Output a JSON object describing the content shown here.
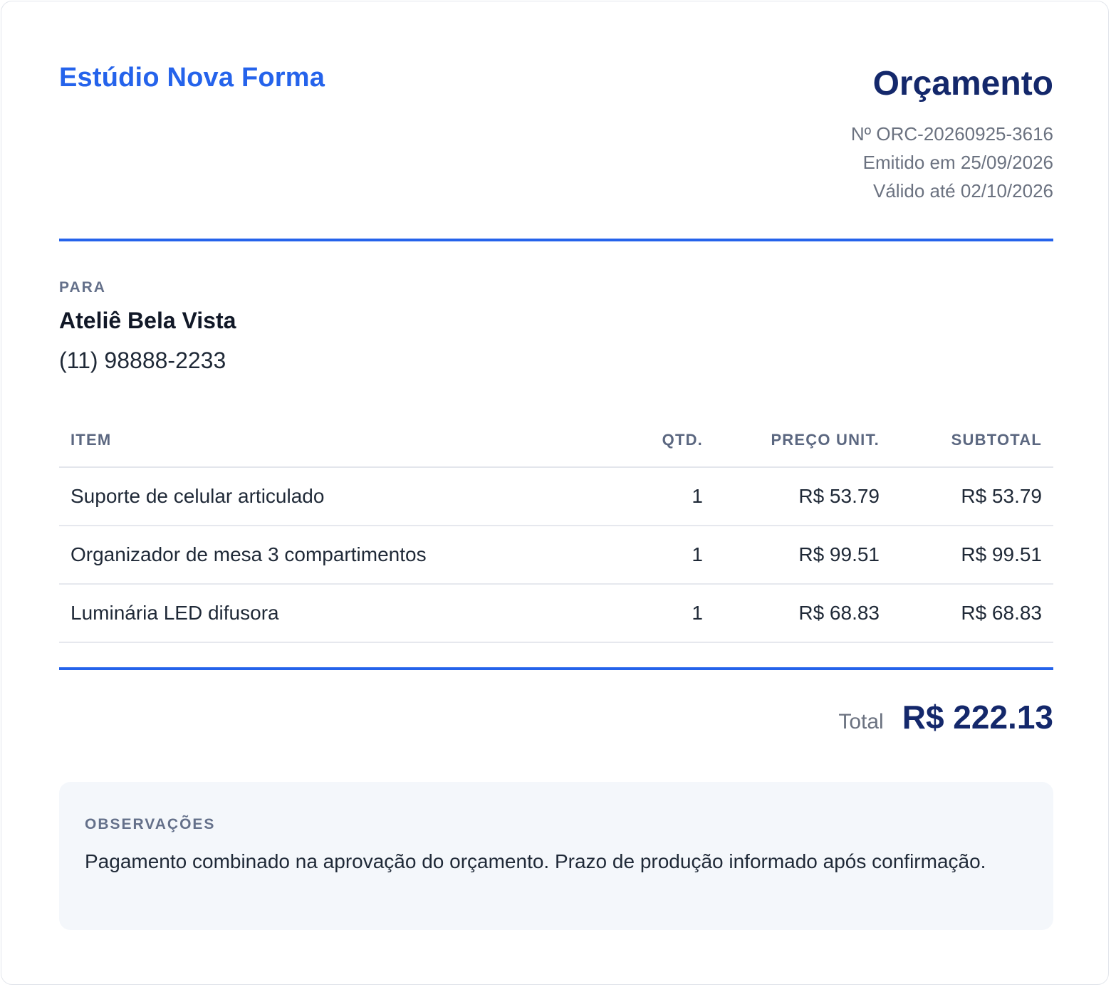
{
  "brand": {
    "name": "Estúdio Nova Forma"
  },
  "document": {
    "title": "Orçamento",
    "number": "Nº ORC-20260925-3616",
    "issued": "Emitido em 25/09/2026",
    "valid_until": "Válido até 02/10/2026"
  },
  "client": {
    "label": "PARA",
    "name": "Ateliê Bela Vista",
    "phone": "(11) 98888-2233"
  },
  "items_table": {
    "headers": {
      "item": "ITEM",
      "qty": "QTD.",
      "unit_price": "PREÇO UNIT.",
      "subtotal": "SUBTOTAL"
    },
    "rows": [
      {
        "item": "Suporte de celular articulado",
        "qty": "1",
        "unit_price": "R$ 53.79",
        "subtotal": "R$ 53.79"
      },
      {
        "item": "Organizador de mesa 3 compartimentos",
        "qty": "1",
        "unit_price": "R$ 99.51",
        "subtotal": "R$ 99.51"
      },
      {
        "item": "Luminária LED difusora",
        "qty": "1",
        "unit_price": "R$ 68.83",
        "subtotal": "R$ 68.83"
      }
    ]
  },
  "total": {
    "label": "Total",
    "value": "R$ 222.13"
  },
  "notes": {
    "label": "OBSERVAÇÕES",
    "text": "Pagamento combinado na aprovação do orçamento. Prazo de produção informado após confirmação."
  },
  "colors": {
    "accent": "#2563eb",
    "heading": "#14286b",
    "muted": "#6b7280",
    "notes_bg": "#f4f7fb"
  }
}
